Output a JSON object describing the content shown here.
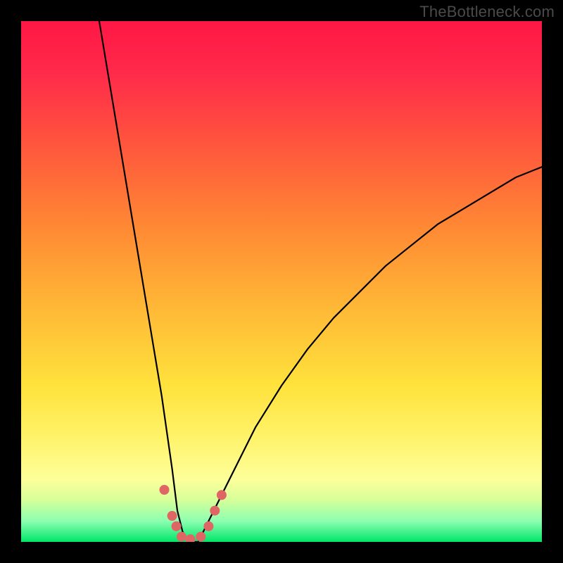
{
  "watermark": "TheBottleneck.com",
  "chart_data": {
    "type": "line",
    "title": "",
    "xlabel": "",
    "ylabel": "",
    "x_range": [
      0,
      100
    ],
    "y_range": [
      0,
      100
    ],
    "grid": false,
    "gradient_stops": [
      {
        "offset": 0.0,
        "color": "#ff1744"
      },
      {
        "offset": 0.1,
        "color": "#ff2a4a"
      },
      {
        "offset": 0.25,
        "color": "#ff5a3c"
      },
      {
        "offset": 0.4,
        "color": "#ff8a34"
      },
      {
        "offset": 0.55,
        "color": "#ffb836"
      },
      {
        "offset": 0.7,
        "color": "#ffe23c"
      },
      {
        "offset": 0.8,
        "color": "#fff36a"
      },
      {
        "offset": 0.88,
        "color": "#fdff9a"
      },
      {
        "offset": 0.92,
        "color": "#d6ff9a"
      },
      {
        "offset": 0.96,
        "color": "#8cffb0"
      },
      {
        "offset": 1.0,
        "color": "#00e56a"
      }
    ],
    "curve": {
      "description": "V-shaped bottleneck curve; y ~ 100 at x≈15, descends to 0 near x≈30, flat near 0 until x≈35, rises with diminishing slope to y≈72 at x=100",
      "x": [
        15,
        17,
        19,
        21,
        23,
        25,
        27,
        29,
        30,
        31,
        32,
        33,
        34,
        35,
        37,
        40,
        45,
        50,
        55,
        60,
        65,
        70,
        75,
        80,
        85,
        90,
        95,
        100
      ],
      "y": [
        100,
        88,
        76,
        64,
        52,
        40,
        28,
        14,
        6,
        2,
        0,
        0,
        0,
        2,
        6,
        12,
        22,
        30,
        37,
        43,
        48,
        53,
        57,
        61,
        64,
        67,
        70,
        72
      ]
    },
    "markers": {
      "color": "#e06666",
      "radius": 7,
      "points": [
        {
          "x": 27.5,
          "y": 10
        },
        {
          "x": 29.0,
          "y": 5
        },
        {
          "x": 29.8,
          "y": 3
        },
        {
          "x": 30.8,
          "y": 1
        },
        {
          "x": 32.5,
          "y": 0.5
        },
        {
          "x": 34.5,
          "y": 1
        },
        {
          "x": 36.0,
          "y": 3
        },
        {
          "x": 37.2,
          "y": 6
        },
        {
          "x": 38.5,
          "y": 9
        }
      ]
    }
  }
}
